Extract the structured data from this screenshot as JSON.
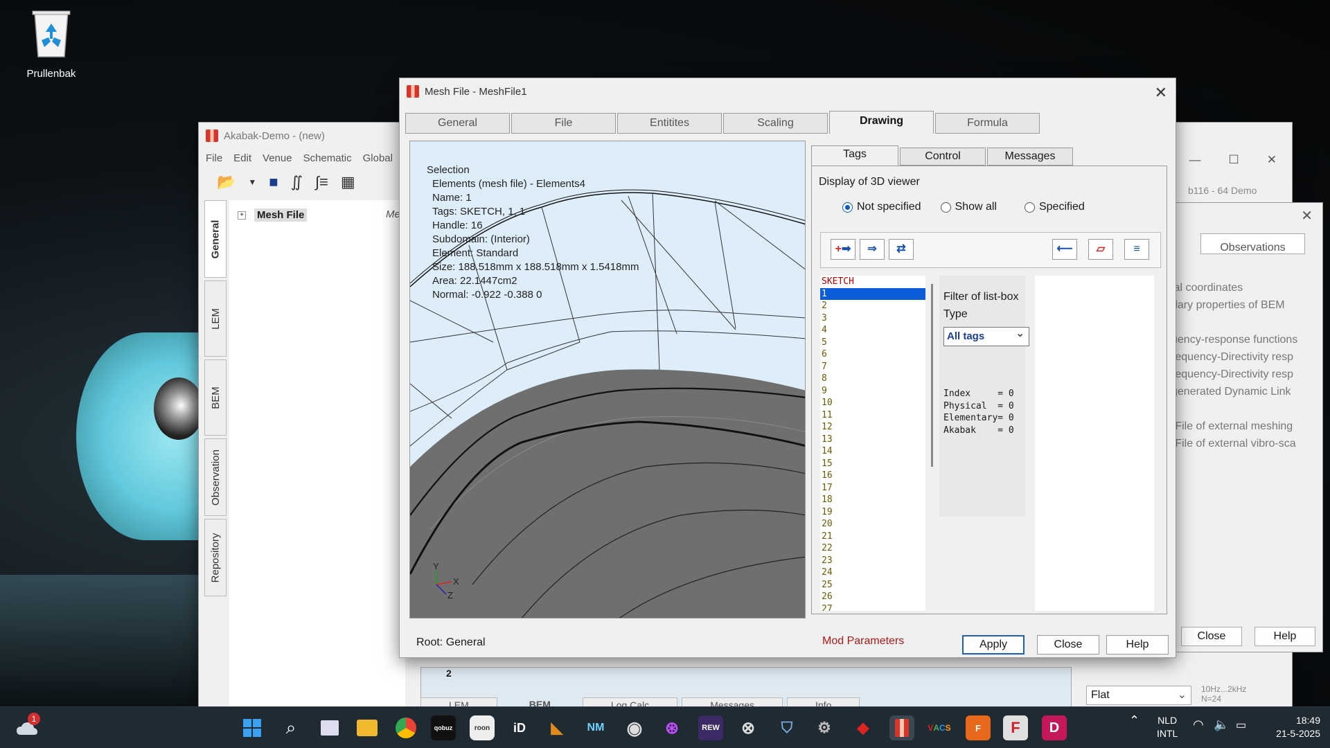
{
  "desktop": {
    "recycle_bin_label": "Prullenbak"
  },
  "akabak": {
    "title": "Akabak-Demo - (new)",
    "menu": [
      "File",
      "Edit",
      "Venue",
      "Schematic",
      "Global"
    ],
    "vtabs": [
      "General",
      "LEM",
      "BEM",
      "Observation",
      "Repository"
    ],
    "tree_item": "Mesh File",
    "tree_col": "Me",
    "version": "b116 - 64 Demo",
    "bottom_tabs": [
      "LEM",
      "BEM",
      "Log Calc",
      "Messages",
      "Info"
    ],
    "bottom_num": "2"
  },
  "observations": {
    "tab": "Observations",
    "lines": [
      "ial coordinates",
      "dary properties of BEM",
      "",
      "uency-response functions",
      "requency-Directivity resp",
      "requency-Directivity resp",
      " generated Dynamic Link",
      "",
      "-File of external meshing",
      "-File of external vibro-sca"
    ],
    "close": "Close",
    "help": "Help",
    "flat": "Flat",
    "hz1": "10Hz...2kHz",
    "hz2": "N=24"
  },
  "mesh": {
    "title": "Mesh File - MeshFile1",
    "tabs": [
      "General",
      "File",
      "Entitites",
      "Scaling",
      "Drawing",
      "Formula"
    ],
    "active_tab": "Drawing",
    "selection": {
      "heading": "Selection",
      "lines": [
        "Elements (mesh file) - Elements4",
        "Name:  1",
        "Tags:   SKETCH, 1, 1",
        "Handle: 16",
        "Subdomain:  (Interior)",
        "Element: Standard",
        "Size: 188.518mm x 188.518mm x 1.5418mm",
        "Area: 22.1447cm2",
        "Normal: -0.922 -0.388 0"
      ]
    },
    "axis_labels": {
      "y": "Y",
      "x": "X",
      "z": "Z"
    },
    "subtabs": [
      "Tags",
      "Control",
      "Messages"
    ],
    "display_title": "Display of 3D viewer",
    "radios": [
      {
        "label": "Not specified",
        "checked": true
      },
      {
        "label": "Show all",
        "checked": false
      },
      {
        "label": "Specified",
        "checked": false
      }
    ],
    "tool_icons": [
      "add-tag-icon",
      "assign-tag-icon",
      "replace-tag-icon",
      "back-arrow-icon",
      "plane-icon",
      "list-icon"
    ],
    "tag_list_header": "SKETCH",
    "tag_list": [
      "1",
      "2",
      "3",
      "4",
      "5",
      "6",
      "7",
      "8",
      "9",
      "10",
      "11",
      "12",
      "13",
      "14",
      "15",
      "16",
      "17",
      "18",
      "19",
      "20",
      "21",
      "22",
      "23",
      "24",
      "25",
      "26",
      "27"
    ],
    "selected_tag": "1",
    "filter": {
      "title": "Filter of list-box",
      "type_label": "Type",
      "type_value": "All tags",
      "counters": [
        "Index     = 0",
        "Physical  = 0",
        "Elementary= 0",
        "Akabak    = 0"
      ]
    },
    "footer": {
      "root": "Root: General",
      "mod": "Mod Parameters",
      "apply": "Apply",
      "close": "Close",
      "help": "Help"
    }
  },
  "taskbar": {
    "badge": "1",
    "apps": [
      "start",
      "search",
      "task-view",
      "file-explorer",
      "chrome",
      "qobuz",
      "roon",
      "iD",
      "app",
      "NM",
      "app",
      "app",
      "REW",
      "app",
      "app",
      "app",
      "app",
      "akabak",
      "VACS",
      "FUS",
      "F",
      "D"
    ],
    "lang1": "NLD",
    "lang2": "INTL",
    "time": "18:49",
    "date": "21-5-2025",
    "accent": "#1a5fc2"
  }
}
